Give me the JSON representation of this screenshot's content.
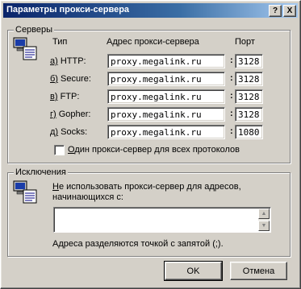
{
  "window": {
    "title": "Параметры прокси-сервера"
  },
  "titlebar_buttons": {
    "help": "?",
    "close": "X"
  },
  "servers": {
    "group_label": "Серверы",
    "header_type": "Тип",
    "header_address": "Адрес прокси-сервера",
    "header_port": "Порт",
    "rows": [
      {
        "key": "а)",
        "label": " HTTP:",
        "address": "proxy.megalink.ru",
        "port": "3128"
      },
      {
        "key": "б)",
        "label": " Secure:",
        "address": "proxy.megalink.ru",
        "port": "3128"
      },
      {
        "key": "в)",
        "label": " FTP:",
        "address": "proxy.megalink.ru",
        "port": "3128"
      },
      {
        "key": "г)",
        "label": " Gopher:",
        "address": "proxy.megalink.ru",
        "port": "3128"
      },
      {
        "key": "д)",
        "label": " Socks:",
        "address": "proxy.megalink.ru",
        "port": "1080"
      }
    ],
    "same_proxy_key": "О",
    "same_proxy_label": "дин прокси-сервер для всех протоколов",
    "same_proxy_checked": false
  },
  "exceptions": {
    "group_label": "Исключения",
    "line1_key": "Н",
    "line1": "е использовать прокси-сервер для адресов,",
    "line2": "начинающихся с:",
    "value": "",
    "note": "Адреса разделяются точкой с запятой (;)."
  },
  "buttons": {
    "ok": "OK",
    "cancel": "Отмена"
  }
}
